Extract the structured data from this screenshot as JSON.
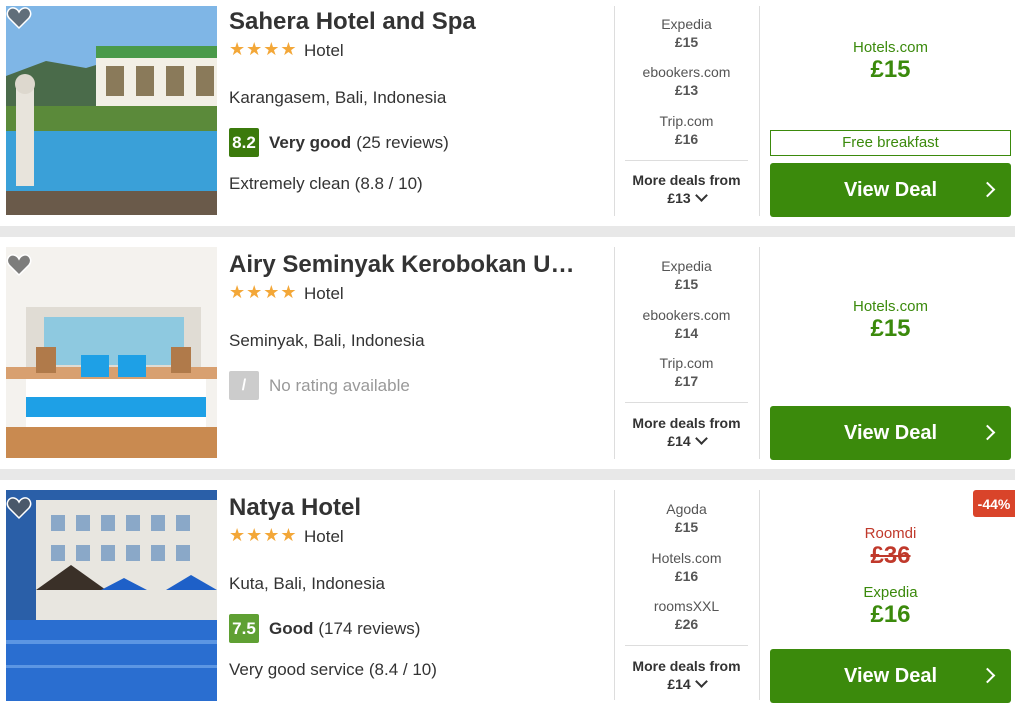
{
  "hotels": [
    {
      "name": "Sahera Hotel and Spa",
      "stars": "★★★★",
      "type": "Hotel",
      "location": "Karangasem, Bali, Indonesia",
      "rating": {
        "score": "8.2",
        "label": "Very good",
        "reviews": "(25 reviews)",
        "color": "#3b7a0c"
      },
      "subrating": "Extremely clean (8.8 / 10)",
      "deals": [
        {
          "provider": "Expedia",
          "price": "£15"
        },
        {
          "provider": "ebookers.com",
          "price": "£13"
        },
        {
          "provider": "Trip.com",
          "price": "£16"
        }
      ],
      "more_deals": {
        "label": "More deals from",
        "price": "£13"
      },
      "best": {
        "provider": "Hotels.com",
        "price": "£15"
      },
      "perk": "Free breakfast",
      "button": "View Deal"
    },
    {
      "name": "Airy Seminyak Kerobokan U…",
      "stars": "★★★★",
      "type": "Hotel",
      "location": "Seminyak, Bali, Indonesia",
      "no_rating": {
        "score": "/",
        "label": "No rating available"
      },
      "deals": [
        {
          "provider": "Expedia",
          "price": "£15"
        },
        {
          "provider": "ebookers.com",
          "price": "£14"
        },
        {
          "provider": "Trip.com",
          "price": "£17"
        }
      ],
      "more_deals": {
        "label": "More deals from",
        "price": "£14"
      },
      "best": {
        "provider": "Hotels.com",
        "price": "£15"
      },
      "button": "View Deal"
    },
    {
      "name": "Natya Hotel",
      "stars": "★★★★",
      "type": "Hotel",
      "location": "Kuta, Bali, Indonesia",
      "rating": {
        "score": "7.5",
        "label": "Good",
        "reviews": "(174 reviews)",
        "color": "#5fa033"
      },
      "subrating": "Very good service (8.4 / 10)",
      "deals": [
        {
          "provider": "Agoda",
          "price": "£15"
        },
        {
          "provider": "Hotels.com",
          "price": "£16"
        },
        {
          "provider": "roomsXXL",
          "price": "£26"
        }
      ],
      "more_deals": {
        "label": "More deals from",
        "price": "£14"
      },
      "discount": "-44%",
      "original": {
        "provider": "Roomdi",
        "price": "£36"
      },
      "best": {
        "provider": "Expedia",
        "price": "£16"
      },
      "button": "View Deal"
    }
  ]
}
